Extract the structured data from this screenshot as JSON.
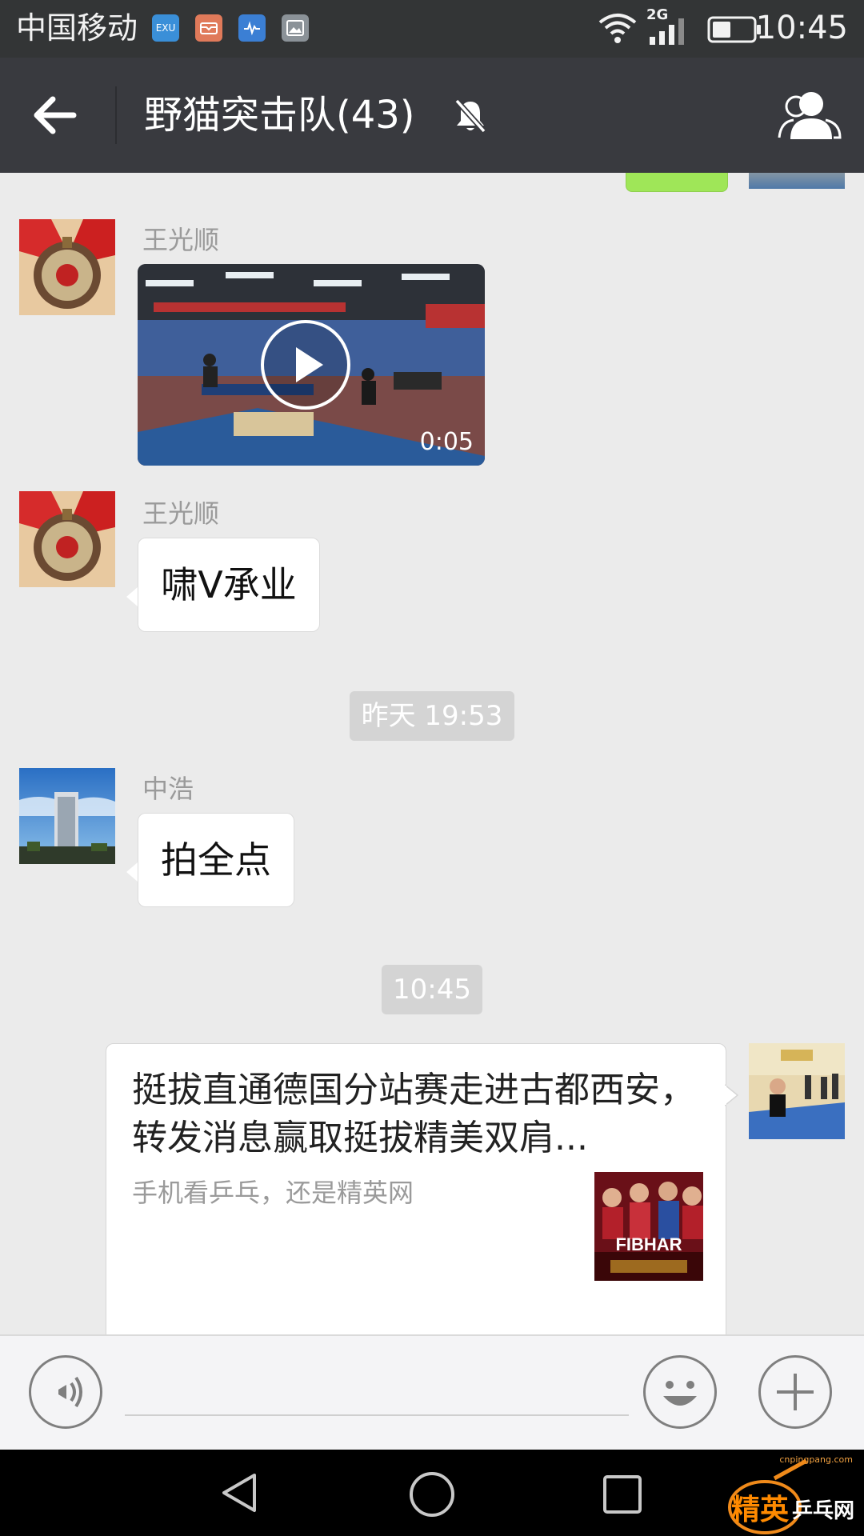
{
  "status_bar": {
    "carrier": "中国移动",
    "network": "2G",
    "time": "10:45",
    "app_icons": [
      "app-icon",
      "mail-icon",
      "health-icon",
      "gallery-icon"
    ]
  },
  "title_bar": {
    "title": "野猫突击队(43)",
    "muted": true
  },
  "messages": [
    {
      "sender": "王光顺",
      "type": "video",
      "duration": "0:05"
    },
    {
      "sender": "王光顺",
      "type": "text",
      "text": "啸V承业"
    },
    {
      "type": "timestamp",
      "text": "昨天 19:53"
    },
    {
      "sender": "中浩",
      "type": "text",
      "text": "拍全点"
    },
    {
      "type": "timestamp",
      "text": "10:45"
    },
    {
      "type": "link_card",
      "title": "挺拔直通德国分站赛走进古都西安，转发消息赢取挺拔精美双肩...",
      "description": "手机看乒乓，还是精英网",
      "thumbnail_brand": "FIBHAR"
    }
  ],
  "input_bar": {
    "placeholder": ""
  },
  "watermark": {
    "domain": "cnpingpang.com",
    "text_orange": "精英",
    "text_white": "乒乓网"
  },
  "colors": {
    "title_bar": "#393a3f",
    "status_bar": "#333536",
    "chat_bg": "#ebebeb",
    "sent_bubble": "#9fe658"
  }
}
